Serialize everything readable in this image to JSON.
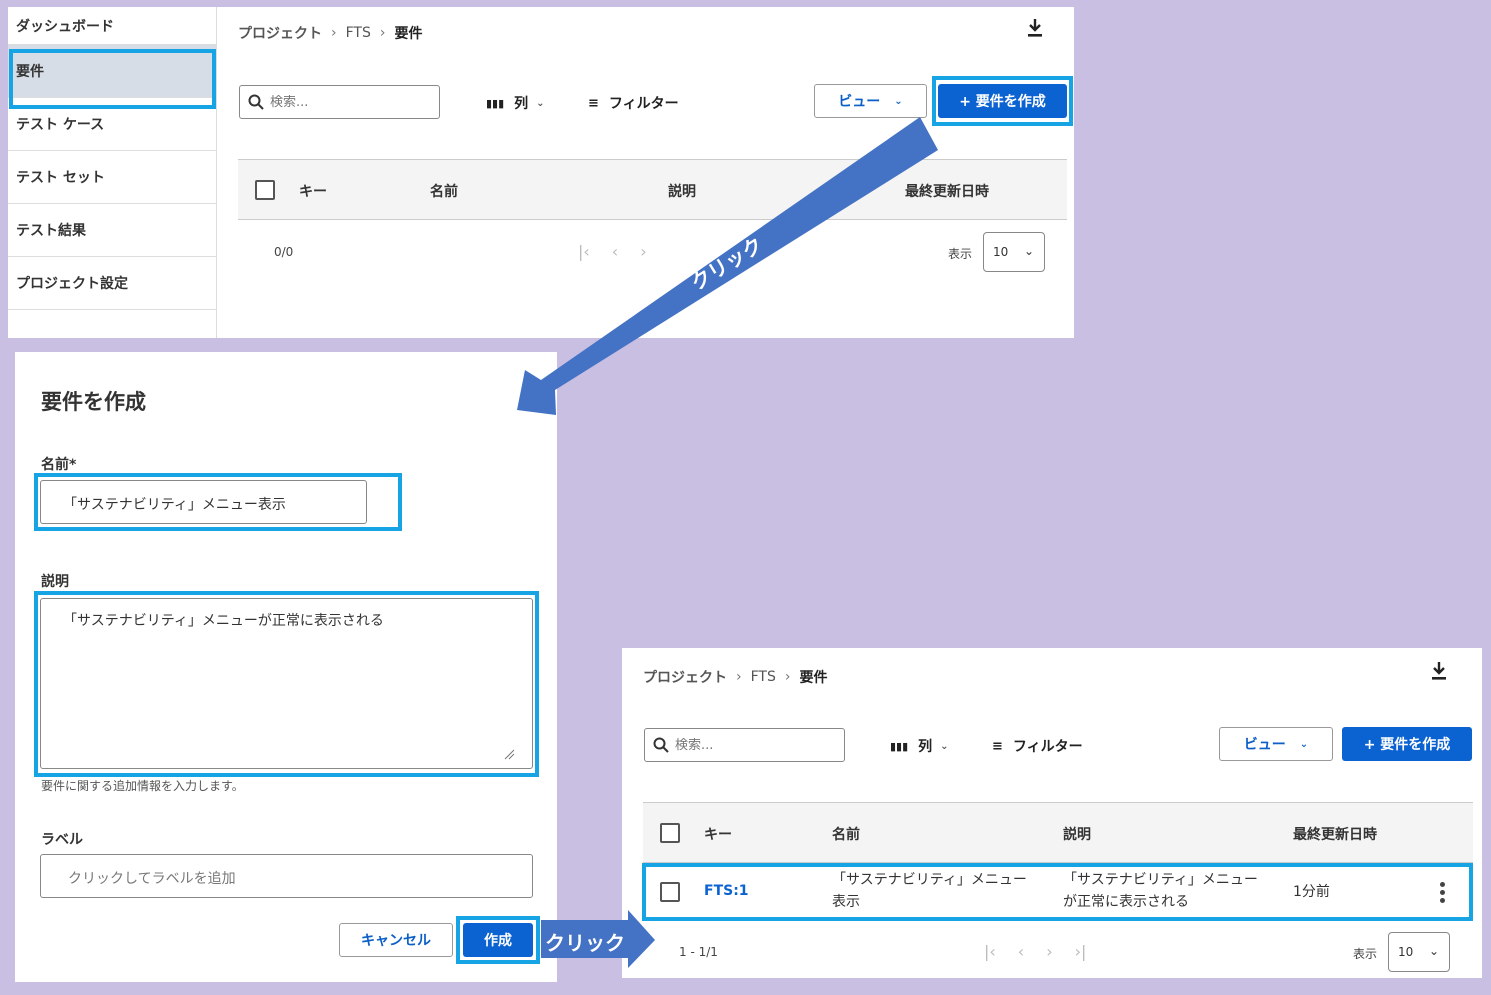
{
  "sidebar": {
    "items": [
      {
        "label": "ダッシュボード"
      },
      {
        "label": "要件"
      },
      {
        "label": "テスト ケース"
      },
      {
        "label": "テスト セット"
      },
      {
        "label": "テスト結果"
      },
      {
        "label": "プロジェクト設定"
      }
    ]
  },
  "breadcrumb": {
    "root": "プロジェクト",
    "project": "FTS",
    "current": "要件"
  },
  "toolbar": {
    "search_placeholder": "検索...",
    "columns_label": "列",
    "filter_label": "フィルター",
    "view_label": "ビュー",
    "create_label": "+ 要件を作成"
  },
  "table": {
    "headers": [
      "キー",
      "名前",
      "説明",
      "最終更新日時"
    ]
  },
  "pagination_before": {
    "count": "0/0",
    "show_label": "表示",
    "page_size": "10"
  },
  "dialog": {
    "title": "要件を作成",
    "name_label": "名前*",
    "name_value": "「サステナビリティ」メニュー表示",
    "desc_label": "説明",
    "desc_value": "「サステナビリティ」メニューが正常に表示される",
    "desc_help": "要件に関する追加情報を入力します。",
    "label_label": "ラベル",
    "label_placeholder": "クリックしてラベルを追加",
    "cancel_label": "キャンセル",
    "create_label": "作成"
  },
  "result_row": {
    "key": "FTS:1",
    "name_line1": "「サステナビリティ」メニュー",
    "name_line2": "表示",
    "desc_line1": "「サステナビリティ」メニュー",
    "desc_line2": "が正常に表示される",
    "updated": "1分前"
  },
  "pagination_after": {
    "count": "1 - 1/1",
    "show_label": "表示",
    "page_size": "10"
  },
  "annotations": {
    "click_label_1": "クリック",
    "click_label_2": "クリック"
  },
  "colors": {
    "accent": "#0b63d1",
    "highlight": "#16a4e4",
    "arrow": "#4472c4",
    "background": "#c8bfe3"
  }
}
